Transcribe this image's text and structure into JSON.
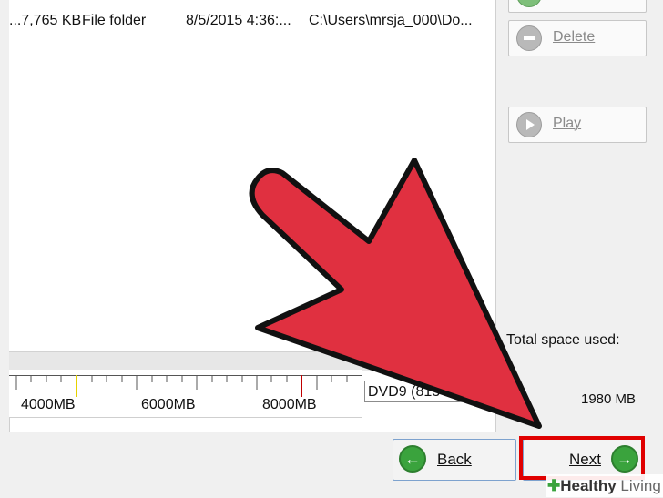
{
  "file_row": {
    "size": "...7,765 KB",
    "type": "File folder",
    "date": "8/5/2015 4:36:...",
    "path": "C:\\Users\\mrsja_000\\Do..."
  },
  "side_buttons": {
    "delete_label": "Delete",
    "play_label": "Play"
  },
  "ruler": {
    "labels": [
      "4000MB",
      "6000MB",
      "8000MB"
    ],
    "disc_type": "DVD9 (813"
  },
  "space": {
    "total_label": "Total space used:",
    "total_value": "1980 MB"
  },
  "nav": {
    "back_label": "Back",
    "next_label": "Next"
  },
  "watermark": {
    "brand_bold": "Healthy",
    "brand_light": "Living"
  },
  "colors": {
    "arrow": "#e03040",
    "highlight": "#e00000",
    "green": "#3aa33d"
  }
}
